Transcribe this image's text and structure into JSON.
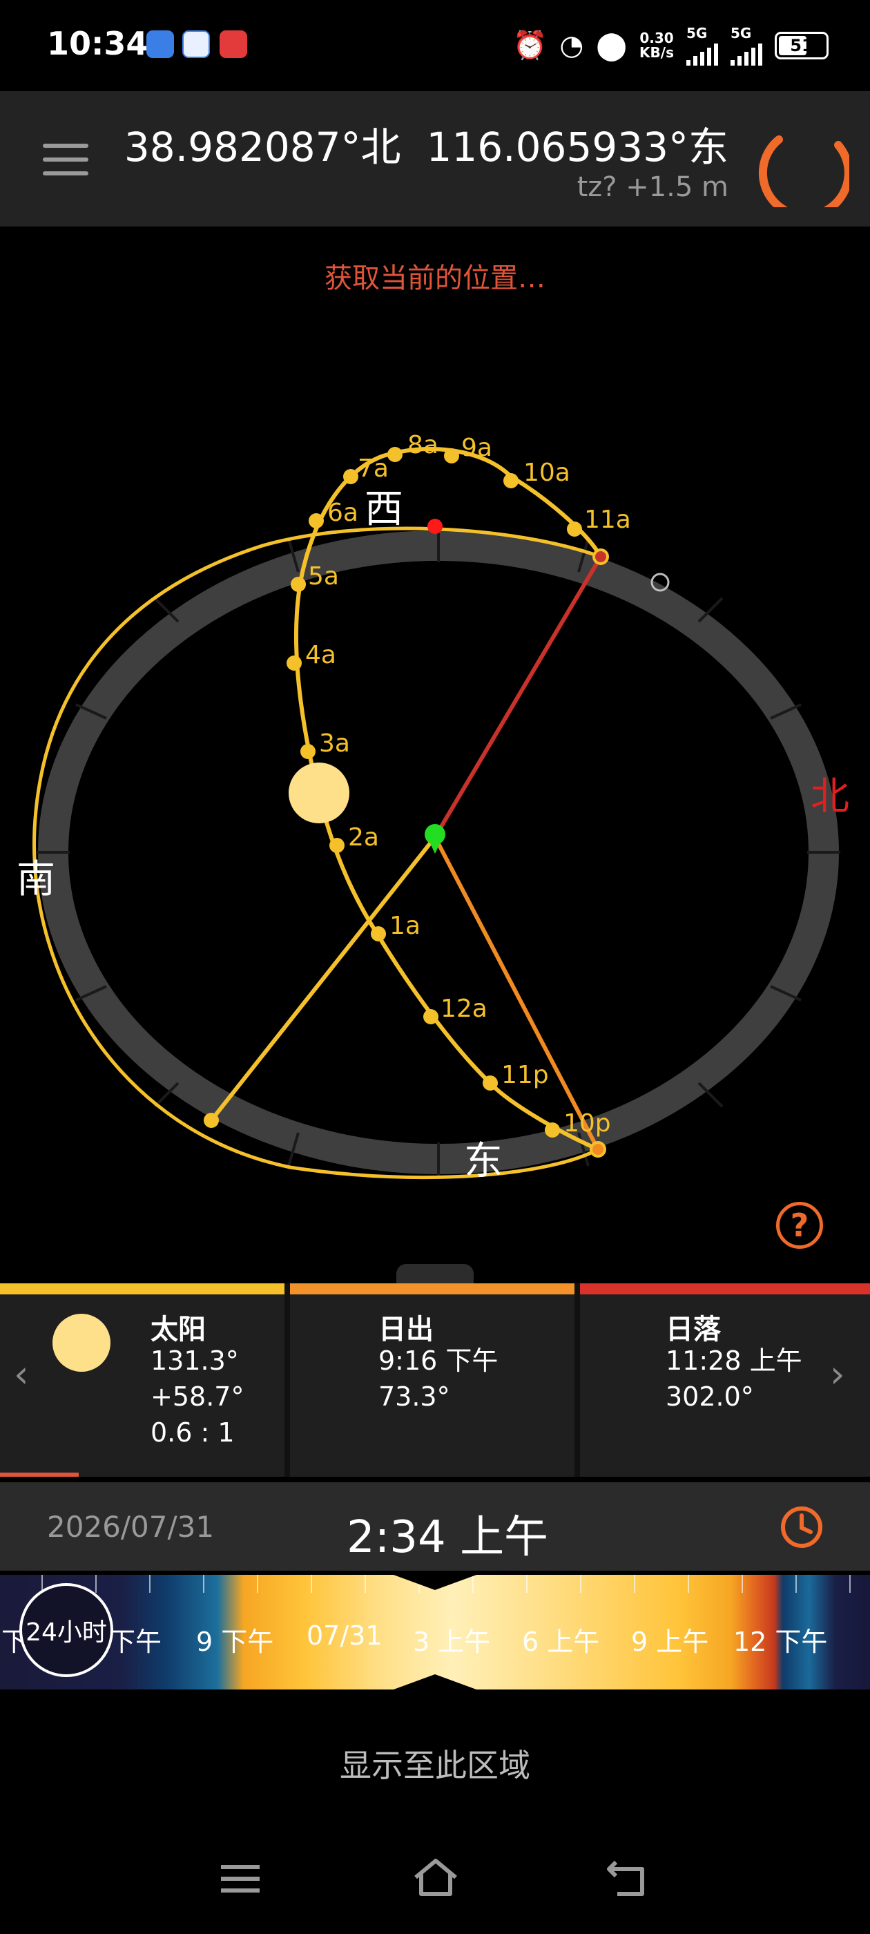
{
  "status_bar": {
    "time": "10:34",
    "net_speed": "0.30",
    "net_unit": "KB/s",
    "sim1": "5G",
    "sim2": "5G",
    "battery": "51"
  },
  "header": {
    "latitude": "38.982087°北",
    "longitude": "116.065933°东",
    "tz_elevation": "tz? +1.5 m"
  },
  "map": {
    "status_message": "获取当前的位置…",
    "compass": {
      "west": "西",
      "north": "北",
      "south": "南",
      "east": "东"
    },
    "hour_labels": [
      "7a",
      "8a",
      "9a",
      "10a",
      "11a",
      "6a",
      "5a",
      "4a",
      "3a",
      "2a",
      "1a",
      "12a",
      "11p",
      "10p"
    ]
  },
  "cards": [
    {
      "title": "太阳",
      "lines": [
        "131.3°",
        "+58.7°",
        "0.6 : 1"
      ],
      "color": "#f5c12a"
    },
    {
      "title": "日出",
      "lines": [
        "9:16 下午",
        "73.3°"
      ],
      "color": "#f2922a"
    },
    {
      "title": "日落",
      "lines": [
        "11:28 上午",
        "302.0°"
      ],
      "color": "#d7332a"
    }
  ],
  "datetime": {
    "date": "2026/07/31",
    "time": "2:34 上午"
  },
  "timeline": {
    "labels": [
      "下",
      "下午",
      "9 下午",
      "07/31",
      "3 上午",
      "6 上午",
      "9 上午",
      "12 下午"
    ],
    "button_24h": "24小时"
  },
  "show_area": "显示至此区域",
  "colors": {
    "accent": "#f06a2a",
    "sun_path": "#f5c12a",
    "sunset": "#c9322a",
    "sunrise": "#f28a22",
    "marker": "#22dd22"
  }
}
